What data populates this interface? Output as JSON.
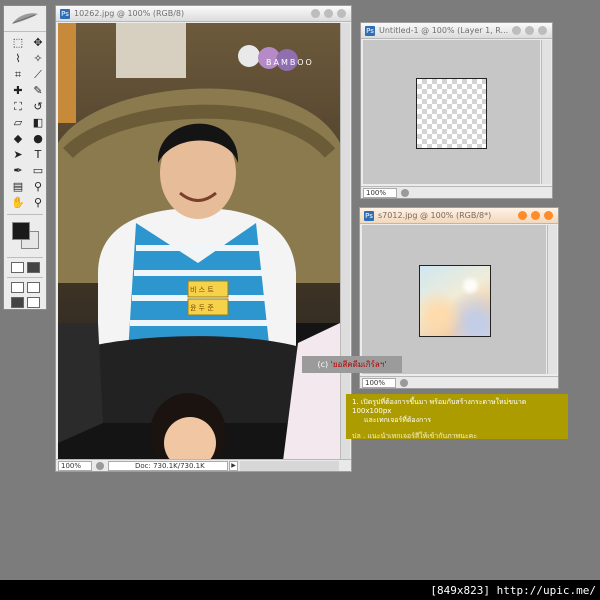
{
  "tools_palette": {
    "logo_icon": "feather-icon",
    "tools": [
      {
        "icon": "marquee-icon",
        "glyph": "⬚"
      },
      {
        "icon": "move-icon",
        "glyph": "✥"
      },
      {
        "icon": "lasso-icon",
        "glyph": "⌇"
      },
      {
        "icon": "magic-wand-icon",
        "glyph": "✧"
      },
      {
        "icon": "crop-icon",
        "glyph": "⌗"
      },
      {
        "icon": "slice-icon",
        "glyph": "⟋"
      },
      {
        "icon": "healing-brush-icon",
        "glyph": "✚"
      },
      {
        "icon": "brush-icon",
        "glyph": "✎"
      },
      {
        "icon": "stamp-icon",
        "glyph": "⛶"
      },
      {
        "icon": "history-brush-icon",
        "glyph": "↺"
      },
      {
        "icon": "eraser-icon",
        "glyph": "▱"
      },
      {
        "icon": "gradient-icon",
        "glyph": "◧"
      },
      {
        "icon": "blur-icon",
        "glyph": "◆"
      },
      {
        "icon": "dodge-icon",
        "glyph": "●"
      },
      {
        "icon": "path-select-icon",
        "glyph": "➤"
      },
      {
        "icon": "type-icon",
        "glyph": "T"
      },
      {
        "icon": "pen-icon",
        "glyph": "✒"
      },
      {
        "icon": "shape-icon",
        "glyph": "▭"
      },
      {
        "icon": "notes-icon",
        "glyph": "▤"
      },
      {
        "icon": "eyedropper-icon",
        "glyph": "⚲"
      },
      {
        "icon": "hand-icon",
        "glyph": "✋"
      },
      {
        "icon": "zoom-icon",
        "glyph": "⚲"
      }
    ],
    "foreground_color": "#1a1a1a",
    "background_color": "#e6e6e6"
  },
  "main_window": {
    "title": "10262.jpg @ 100% (RGB/8)",
    "zoom": "100%",
    "doc_info": "Doc: 730.1K/730.1K",
    "watermark": "BAMBOO",
    "badge_line1": "비 스 트",
    "badge_line2": "윤 두 준"
  },
  "untitled_window": {
    "title": "Untitled-1 @ 100% (Layer 1, R...",
    "zoom": "100%"
  },
  "texture_window": {
    "title": "s7012.jpg @ 100% (RGB/8*)",
    "zoom": "100%"
  },
  "credit": {
    "prefix": "(c)",
    "text": "'ยอสีคดีมเกิร์ลฯ'"
  },
  "instructions": {
    "line1": "1.  เปิดรูปที่ต้องการขึ้นมา พร้อมกับสร้างกระดาษใหม่ขนาด 100x100px",
    "line2": "และเทกเจอร์ที่ต้องการ",
    "line3": "ปล . แนะนำเทกเจอร์สีให้เข้ากับภาพนะคะ"
  },
  "footer": "[849x823] http://upic.me/"
}
